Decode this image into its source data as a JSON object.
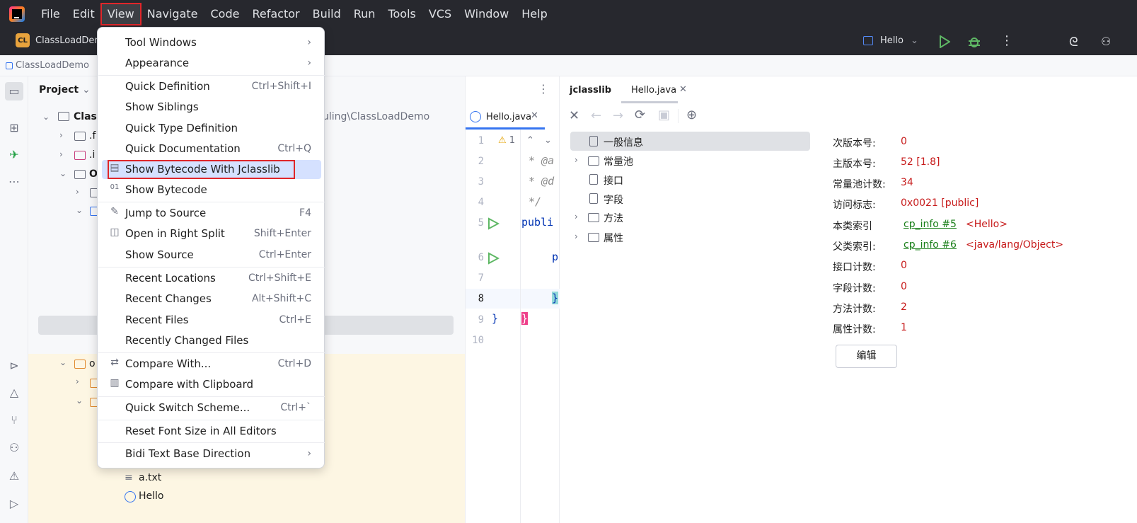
{
  "menubar": {
    "items": [
      {
        "label": "File"
      },
      {
        "label": "Edit"
      },
      {
        "label": "View"
      },
      {
        "label": "Navigate"
      },
      {
        "label": "Code"
      },
      {
        "label": "Refactor"
      },
      {
        "label": "Build"
      },
      {
        "label": "Run"
      },
      {
        "label": "Tools"
      },
      {
        "label": "VCS"
      },
      {
        "label": "Window"
      },
      {
        "label": "Help"
      }
    ]
  },
  "toolbar": {
    "project_badge": "CL",
    "project_name": "ClassLoadDem",
    "run_config": "Hello"
  },
  "breadcrumb": {
    "root": "ClassLoadDemo"
  },
  "project_panel": {
    "title": "Project",
    "tree": [
      {
        "label": "Class"
      },
      {
        "label": ".f"
      },
      {
        "label": ".i"
      },
      {
        "label": "O"
      },
      {
        "label": "o"
      },
      {
        "label": "a.txt"
      },
      {
        "label": "Hello"
      }
    ],
    "path_fragment": "uling\\ClassLoadDemo"
  },
  "view_menu": {
    "items": [
      {
        "label": "Tool Windows",
        "shortcut": "",
        "submenu": true
      },
      {
        "label": "Appearance",
        "shortcut": "",
        "submenu": true
      },
      {
        "label": "Quick Definition",
        "shortcut": "Ctrl+Shift+I"
      },
      {
        "label": "Show Siblings",
        "shortcut": ""
      },
      {
        "label": "Quick Type Definition",
        "shortcut": ""
      },
      {
        "label": "Quick Documentation",
        "shortcut": "Ctrl+Q"
      },
      {
        "label": "Show Bytecode With Jclasslib",
        "shortcut": ""
      },
      {
        "label": "Show Bytecode",
        "shortcut": "",
        "icon_text": "01"
      },
      {
        "label": "Jump to Source",
        "shortcut": "F4"
      },
      {
        "label": "Open in Right Split",
        "shortcut": "Shift+Enter"
      },
      {
        "label": "Show Source",
        "shortcut": "Ctrl+Enter"
      },
      {
        "label": "Recent Locations",
        "shortcut": "Ctrl+Shift+E"
      },
      {
        "label": "Recent Changes",
        "shortcut": "Alt+Shift+C"
      },
      {
        "label": "Recent Files",
        "shortcut": "Ctrl+E"
      },
      {
        "label": "Recently Changed Files",
        "shortcut": ""
      },
      {
        "label": "Compare With...",
        "shortcut": "Ctrl+D"
      },
      {
        "label": "Compare with Clipboard",
        "shortcut": ""
      },
      {
        "label": "Quick Switch Scheme...",
        "shortcut": "Ctrl+`"
      },
      {
        "label": "Reset Font Size in All Editors",
        "shortcut": ""
      },
      {
        "label": "Bidi Text Base Direction",
        "shortcut": "",
        "submenu": true
      }
    ]
  },
  "editor": {
    "tab": "Hello.java",
    "warning_count": "1",
    "lines": [
      "1",
      "2",
      "3",
      "4",
      "5",
      "6",
      "7",
      "8",
      "9",
      "10"
    ],
    "code": {
      "l2": "* @a",
      "l3": "* @d",
      "l4": "*/",
      "l5": "publi",
      "l6": "p",
      "l8": "}",
      "l9": "}",
      "l9b": "}"
    }
  },
  "jclasslib": {
    "tab_main": "jclasslib",
    "tab_file": "Hello.java",
    "tree": [
      "一般信息",
      "常量池",
      "接口",
      "字段",
      "方法",
      "属性"
    ],
    "fields": [
      {
        "label": "次版本号:",
        "value": "0"
      },
      {
        "label": "主版本号:",
        "value": "52 [1.8]"
      },
      {
        "label": "常量池计数:",
        "value": "34"
      },
      {
        "label": "访问标志:",
        "value": "0x0021 [public]"
      },
      {
        "label": "本类索引",
        "link": "cp_info #5",
        "value": "<Hello>"
      },
      {
        "label": "父类索引:",
        "link": "cp_info #6",
        "value": "<java/lang/Object>"
      },
      {
        "label": "接口计数:",
        "value": "0"
      },
      {
        "label": "字段计数:",
        "value": "0"
      },
      {
        "label": "方法计数:",
        "value": "2"
      },
      {
        "label": "属性计数:",
        "value": "1"
      }
    ],
    "edit_button": "编辑"
  },
  "colors": {
    "menubar_bg": "#27282e",
    "highlight": "#d5e1ff",
    "annotation_red": "#e0262a",
    "value_red": "#c71b1b",
    "link_green": "#1a7f1a"
  }
}
